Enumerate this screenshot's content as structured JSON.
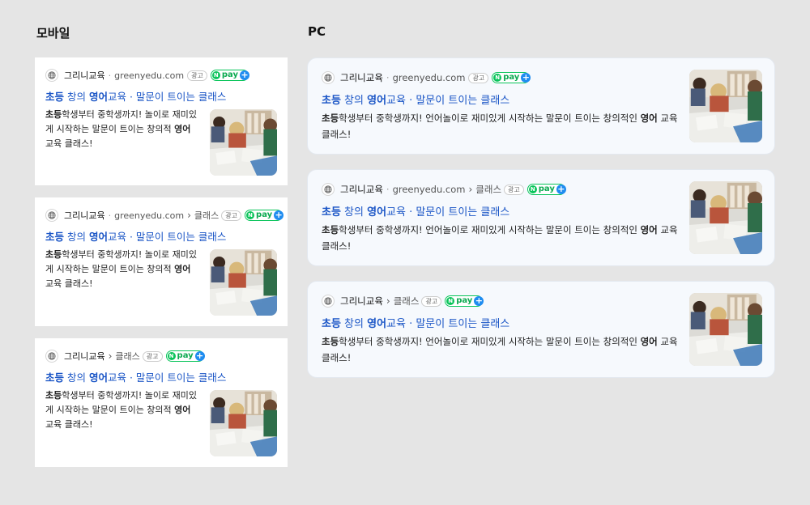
{
  "sections": {
    "mobile_title": "모바일",
    "pc_title": "PC"
  },
  "ad": {
    "advertiser": "그리니교육",
    "separator": "·",
    "domain": "greenyedu.com",
    "breadcrumb_chevron": "›",
    "breadcrumb_label": "클래스",
    "ad_badge": "광고",
    "npay": {
      "n": "N",
      "pay": "pay",
      "plus": "+"
    },
    "headline": {
      "part1": "초등",
      "part2": " 창의 ",
      "part3": "영어",
      "part4": "교육 · 말문이 트이는 클래스"
    },
    "description": {
      "bold1": "초등",
      "mobile_text1": "학생부터 중학생까지! 놀이로 재미있게 시작하는 말문이 트이는 창의적 ",
      "pc_text1": "학생부터 중학생까지! 언어놀이로 재미있게 시작하는 말문이 트이는 창의적인 ",
      "bold2": "영어",
      "text2": " 교육 클래스!"
    }
  },
  "colors": {
    "background": "#e5e5e5",
    "headline_blue": "#1a55c6",
    "npay_green": "#09c45a",
    "npay_plus_blue": "#1f8cf0",
    "pc_card_bg": "#f6f9fd"
  },
  "icons": {
    "globe": "globe-icon",
    "chevron": "chevron-right-icon",
    "npay": "npay-plus-badge"
  }
}
